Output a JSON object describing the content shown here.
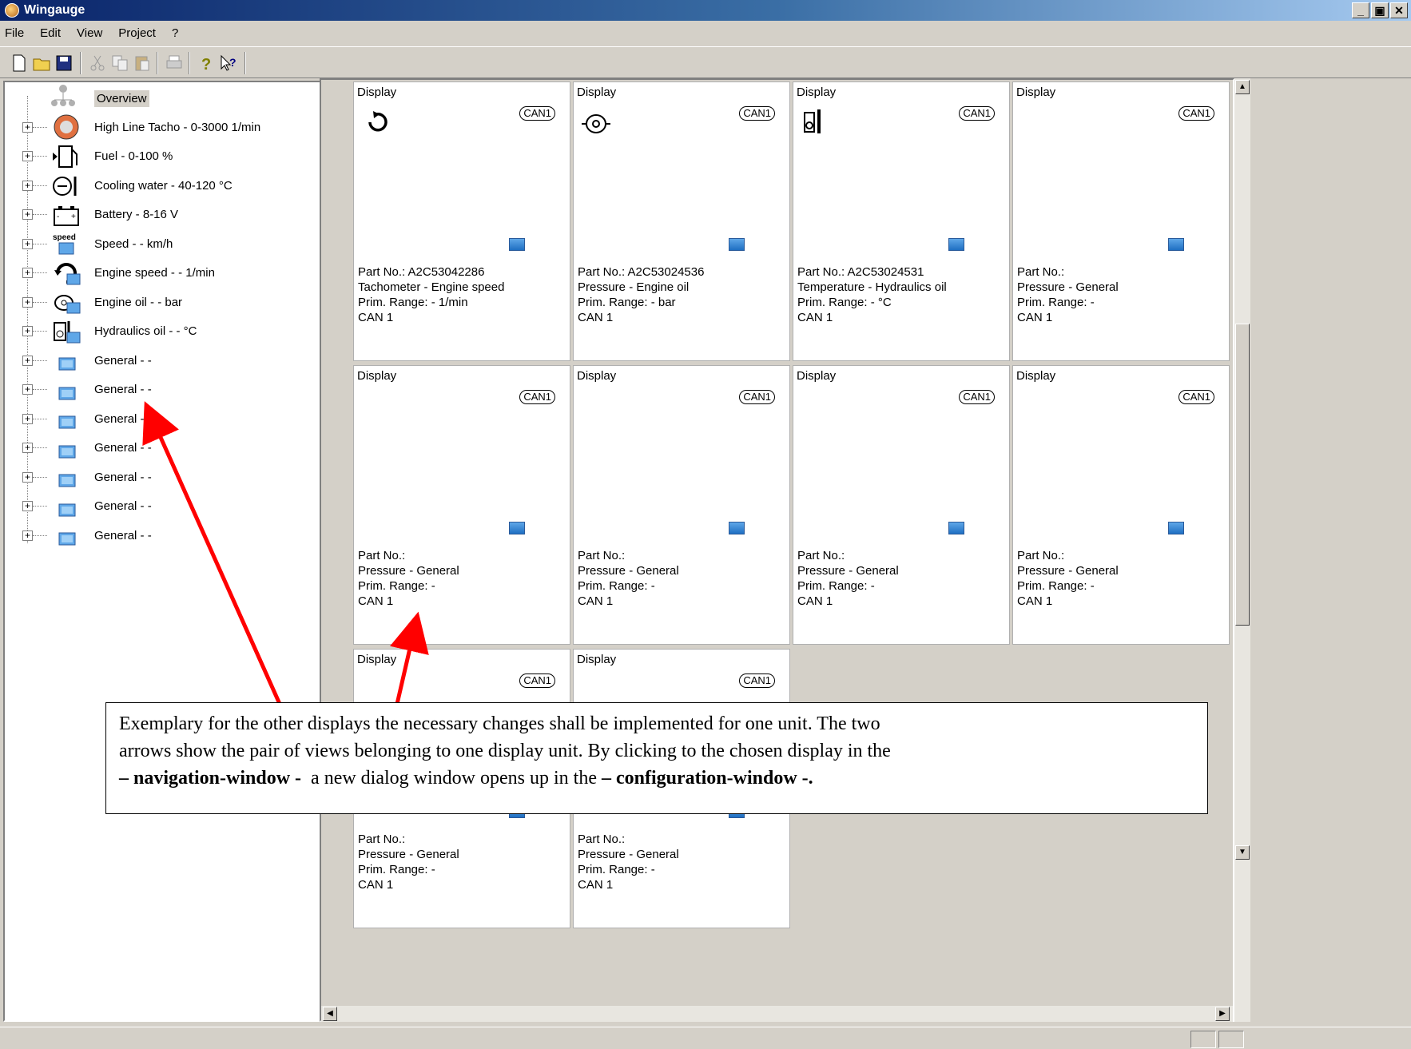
{
  "window": {
    "title": "Wingauge"
  },
  "menu": [
    "File",
    "Edit",
    "View",
    "Project",
    "?"
  ],
  "tree": {
    "root": "Overview",
    "items": [
      "High Line Tacho - 0-3000 1/min",
      "Fuel - 0-100 %",
      "Cooling water - 40-120 °C",
      "Battery - 8-16 V",
      "Speed - - km/h",
      "Engine speed - - 1/min",
      "Engine oil - - bar",
      "Hydraulics oil - - °C",
      "General - -",
      "General - -",
      "General - -",
      "General - -",
      "General - -",
      "General - -",
      "General - -"
    ],
    "speed_icon_text": "speed"
  },
  "cards": [
    {
      "title": "Display",
      "can": "CAN1",
      "part": "Part No.: A2C53042286",
      "type": "Tachometer - Engine speed",
      "range": "Prim. Range: - 1/min",
      "bus": "CAN 1",
      "icon": "rotation-icon"
    },
    {
      "title": "Display",
      "can": "CAN1",
      "part": "Part No.: A2C53024536",
      "type": "Pressure - Engine oil",
      "range": "Prim. Range: - bar",
      "bus": "CAN 1",
      "icon": "oil-can-icon"
    },
    {
      "title": "Display",
      "can": "CAN1",
      "part": "Part No.: A2C53024531",
      "type": "Temperature - Hydraulics oil",
      "range": "Prim. Range: - °C",
      "bus": "CAN 1",
      "icon": "hydraulic-temp-icon"
    },
    {
      "title": "Display",
      "can": "CAN1",
      "part": "Part No.:",
      "type": "Pressure - General",
      "range": "Prim. Range: -",
      "bus": "CAN 1",
      "icon": ""
    },
    {
      "title": "Display",
      "can": "CAN1",
      "part": "Part No.:",
      "type": "Pressure - General",
      "range": "Prim. Range: -",
      "bus": "CAN 1",
      "icon": ""
    },
    {
      "title": "Display",
      "can": "CAN1",
      "part": "Part No.:",
      "type": "Pressure - General",
      "range": "Prim. Range: -",
      "bus": "CAN 1",
      "icon": ""
    },
    {
      "title": "Display",
      "can": "CAN1",
      "part": "Part No.:",
      "type": "Pressure - General",
      "range": "Prim. Range: -",
      "bus": "CAN 1",
      "icon": ""
    },
    {
      "title": "Display",
      "can": "CAN1",
      "part": "Part No.:",
      "type": "Pressure - General",
      "range": "Prim. Range: -",
      "bus": "CAN 1",
      "icon": ""
    },
    {
      "title": "Display",
      "can": "CAN1",
      "part": "Part No.:",
      "type": "Pressure - General",
      "range": "Prim. Range: -",
      "bus": "CAN 1",
      "icon": ""
    },
    {
      "title": "Display",
      "can": "CAN1",
      "part": "Part No.:",
      "type": "Pressure - General",
      "range": "Prim. Range: -",
      "bus": "CAN 1",
      "icon": ""
    }
  ],
  "annotation": {
    "line1": "Exemplary for the other displays the necessary changes shall be implemented for one unit. The two",
    "line2": "arrows show the pair of views belonging to one display unit. By clicking to the chosen display in the",
    "line3_pre": "– ",
    "line3_b1": "navigation-window -",
    "line3_mid": "  a new dialog window opens up in the ",
    "line3_b2": "– configuration-window -.",
    "arrow_color": "#ff0000"
  }
}
